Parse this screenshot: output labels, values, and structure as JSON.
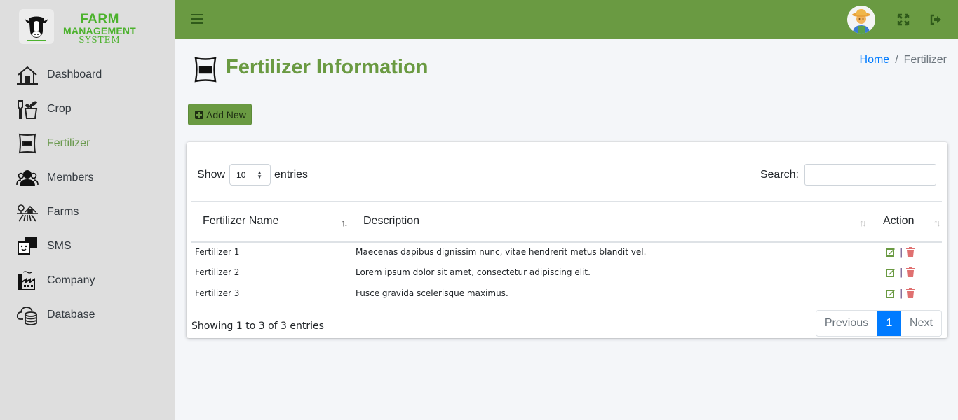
{
  "brand": {
    "line1": "FARM",
    "line2": "MANAGEMENT",
    "line3": "SYSTEM"
  },
  "sidebar": {
    "items": [
      {
        "label": "Dashboard",
        "icon": "house-icon",
        "active": false
      },
      {
        "label": "Crop",
        "icon": "plant-pot-icon",
        "active": false
      },
      {
        "label": "Fertilizer",
        "icon": "fertilizer-bag-icon",
        "active": true
      },
      {
        "label": "Members",
        "icon": "users-icon",
        "active": false
      },
      {
        "label": "Farms",
        "icon": "farm-icon",
        "active": false
      },
      {
        "label": "SMS",
        "icon": "chat-icon",
        "active": false
      },
      {
        "label": "Company",
        "icon": "factory-icon",
        "active": false
      },
      {
        "label": "Database",
        "icon": "cloud-database-icon",
        "active": false
      }
    ]
  },
  "topbar": {
    "menu_icon": "hamburger-icon",
    "avatar": "farmer-avatar",
    "fullscreen_icon": "expand-icon",
    "logout_icon": "sign-out-icon"
  },
  "page": {
    "title": "Fertilizer Information",
    "add_label": "Add New"
  },
  "breadcrumb": {
    "home": "Home",
    "separator": "/",
    "current": "Fertilizer"
  },
  "table": {
    "show_label": "Show",
    "length_value": "10",
    "entries_label": "entries",
    "search_label": "Search:",
    "search_value": "",
    "columns": [
      "Fertilizer Name",
      "Description",
      "Action"
    ],
    "rows": [
      {
        "name": "Fertilizer 1",
        "description": "Maecenas dapibus dignissim nunc, vitae hendrerit metus blandit vel."
      },
      {
        "name": "Fertilizer 2",
        "description": "Lorem ipsum dolor sit amet, consectetur adipiscing elit."
      },
      {
        "name": "Fertilizer 3",
        "description": "Fusce gravida scelerisque maximus."
      }
    ],
    "action_separator": "|",
    "info": "Showing 1 to 3 of 3 entries",
    "pagination": {
      "previous": "Previous",
      "current": "1",
      "next": "Next"
    }
  },
  "colors": {
    "primary_green": "#6a9a42",
    "brand_green": "#4cb22d",
    "link_blue": "#007bff",
    "delete_red": "#e07070"
  }
}
